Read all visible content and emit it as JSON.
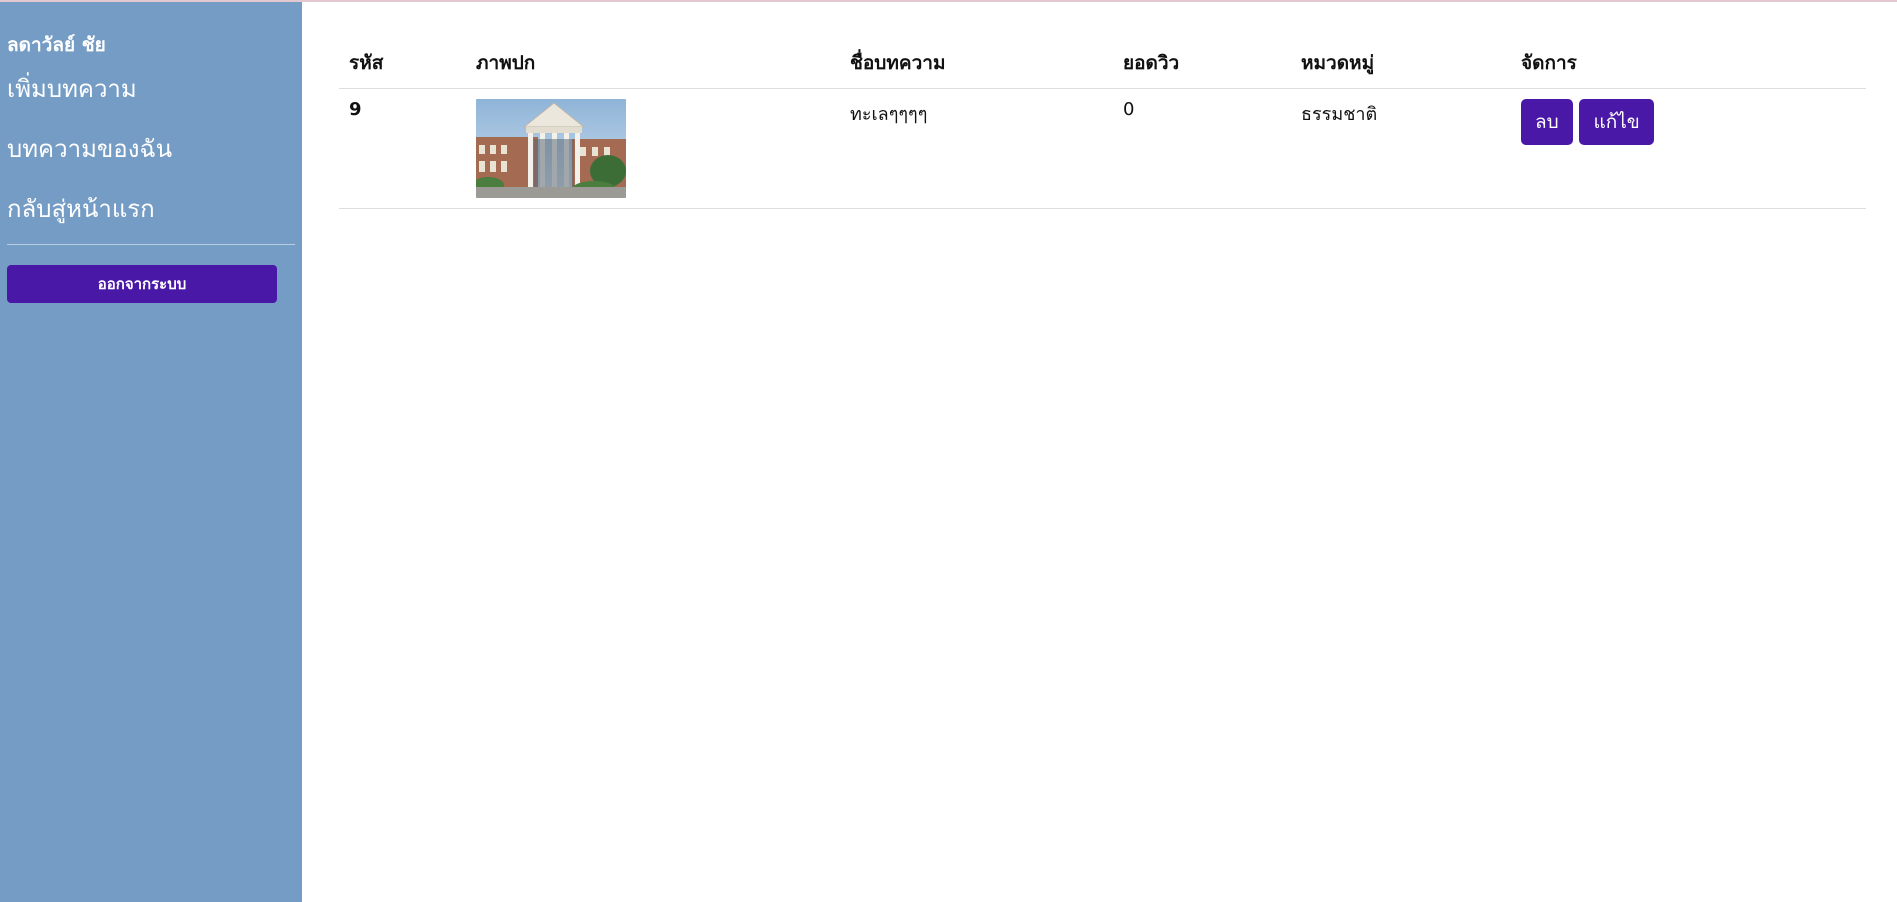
{
  "sidebar": {
    "user_name": "ลดาวัลย์ ชัย",
    "links": [
      {
        "label": "เพิ่มบทความ"
      },
      {
        "label": "บทความของฉัน"
      },
      {
        "label": "กลับสู่หน้าแรก"
      }
    ],
    "logout_label": "ออกจากระบบ"
  },
  "table": {
    "headers": [
      "รหัส",
      "ภาพปก",
      "ชื่อบทความ",
      "ยอดวิว",
      "หมวดหมู่",
      "จัดการ"
    ],
    "rows": [
      {
        "id": "9",
        "title": "ทะเลๆๆๆๆ",
        "views": "0",
        "category": "ธรรมชาติ",
        "delete_label": "ลบ",
        "edit_label": "แก้ไข"
      }
    ]
  },
  "colors": {
    "sidebar_bg": "#759cc4",
    "button_bg": "#4a18a7"
  }
}
